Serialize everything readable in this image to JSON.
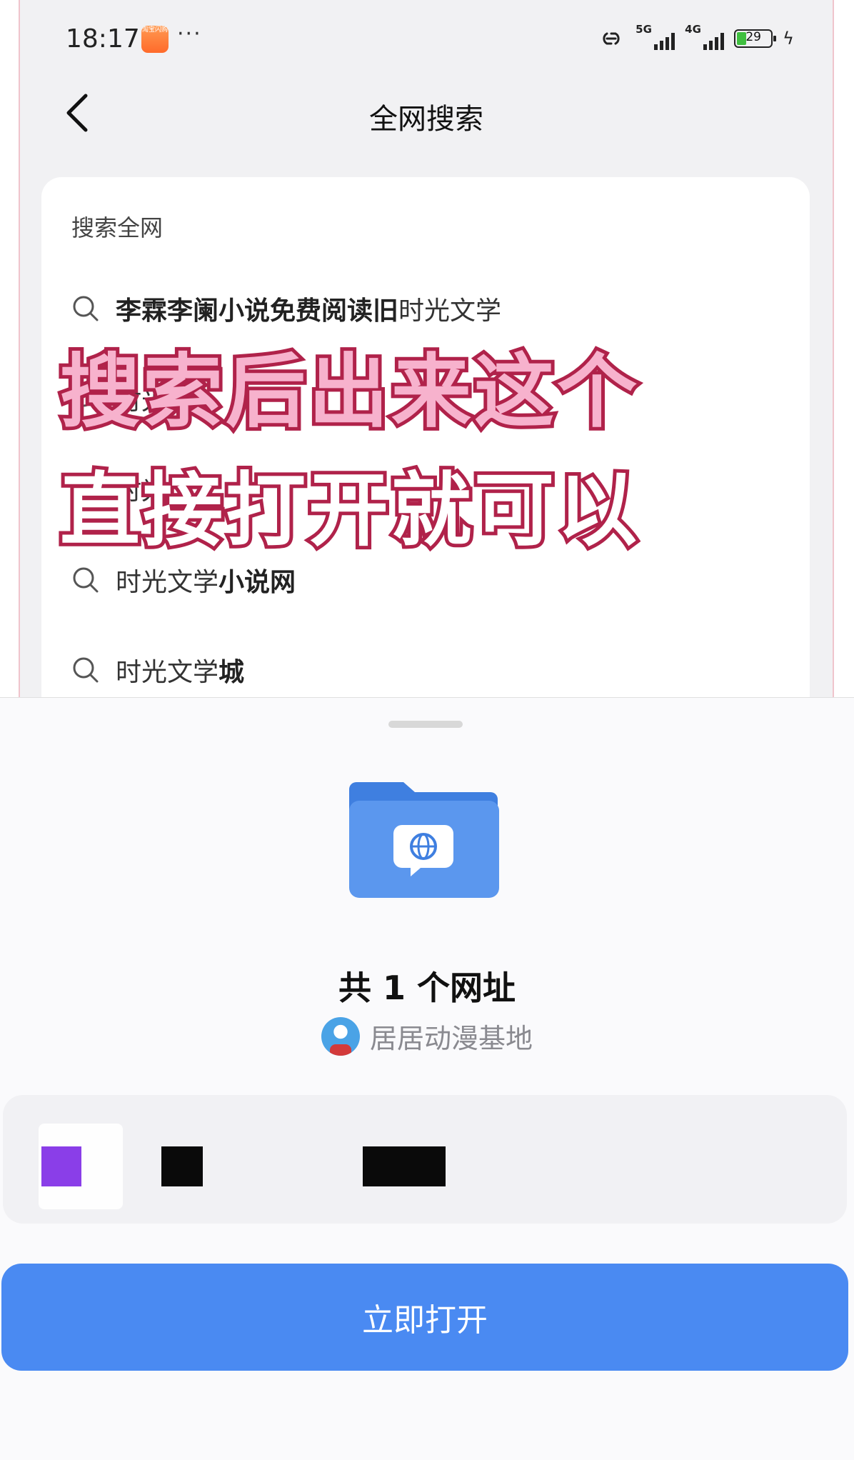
{
  "status_bar": {
    "time": "18:17",
    "app_badge": "淘宝闪购",
    "more": "···",
    "signal_1_label": "5G",
    "signal_2_label": "4G",
    "battery_level": "29",
    "battery_fraction": 0.29
  },
  "nav": {
    "title": "全网搜索"
  },
  "search_card": {
    "heading": "搜索全网",
    "suggestions": [
      {
        "bold": "李霖李阑小说免费阅读旧",
        "normal": "时光文学"
      },
      {
        "bold": "",
        "normal": "时光"
      },
      {
        "bold": "",
        "normal": "时光"
      },
      {
        "bold": "小说网",
        "normal": "时光文学"
      },
      {
        "bold": "城",
        "normal": "时光文学"
      }
    ]
  },
  "overlay": {
    "line1": "搜索后出来这个",
    "line2": "直接打开就可以"
  },
  "sheet": {
    "title": "共 1 个网址",
    "source_name": "居居动漫基地",
    "open_button": "立即打开"
  },
  "colors": {
    "accent": "#4a8af2",
    "folder": "#5b97ee",
    "overlay_stroke": "#b0224a",
    "overlay_pink": "#f7b2cd"
  }
}
